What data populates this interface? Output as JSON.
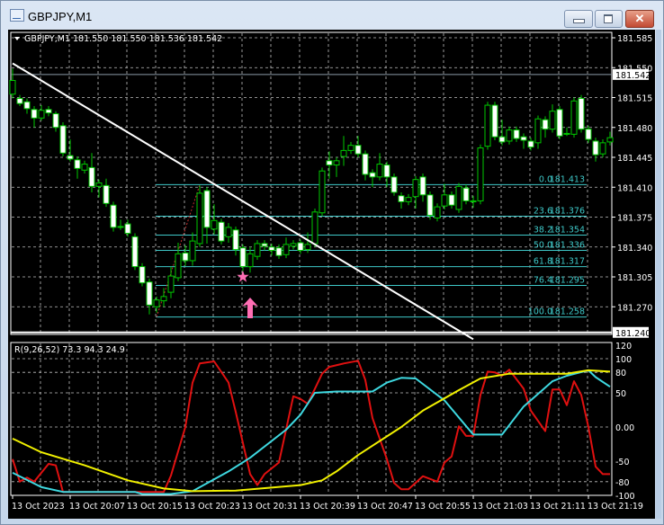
{
  "window": {
    "title": "GBPJPY,M1",
    "close_glyph": "✕"
  },
  "chart": {
    "header": "GBPJPY,M1  181.550 181.550 181.536 181.542",
    "colors": {
      "background": "#000000",
      "bull_body": "#000000",
      "bear_body": "#ffffff",
      "candle_outline": "#00c800",
      "grid": "#c0c0c0",
      "fib": "#3ec8c8",
      "trendline": "#ffffff",
      "marker": "#ff6eb4"
    },
    "price_axis": [
      "181.585",
      "181.550",
      "181.515",
      "181.480",
      "181.445",
      "181.410",
      "181.375",
      "181.340",
      "181.305",
      "181.270"
    ],
    "bid_price": "181.542",
    "hline_price": "181.240",
    "first_bar_time": "19:59",
    "time_axis": [
      {
        "time": "19:59",
        "label": "13 Oct 2023"
      },
      {
        "time": "20:07",
        "label": "13 Oct 20:07"
      },
      {
        "time": "20:15",
        "label": "13 Oct 20:15"
      },
      {
        "time": "20:23",
        "label": "13 Oct 20:23"
      },
      {
        "time": "20:31",
        "label": "13 Oct 20:31"
      },
      {
        "time": "20:39",
        "label": "13 Oct 20:39"
      },
      {
        "time": "20:47",
        "label": "13 Oct 20:47"
      },
      {
        "time": "20:55",
        "label": "13 Oct 20:55"
      },
      {
        "time": "21:03",
        "label": "13 Oct 21:03"
      },
      {
        "time": "21:11",
        "label": "13 Oct 21:11"
      },
      {
        "time": "21:19",
        "label": "13 Oct 21:19"
      }
    ],
    "candles_ohlc": [
      [
        181.519,
        181.549,
        181.514,
        181.535
      ],
      [
        181.514,
        181.518,
        181.505,
        181.508
      ],
      [
        181.51,
        181.514,
        181.496,
        181.502
      ],
      [
        181.501,
        181.505,
        181.48,
        181.491
      ],
      [
        181.491,
        181.506,
        181.488,
        181.5
      ],
      [
        181.501,
        181.505,
        181.493,
        181.497
      ],
      [
        181.496,
        181.499,
        181.475,
        181.48
      ],
      [
        181.482,
        181.486,
        181.446,
        181.45
      ],
      [
        181.447,
        181.466,
        181.44,
        181.443
      ],
      [
        181.442,
        181.446,
        181.42,
        181.432
      ],
      [
        181.43,
        181.441,
        181.426,
        181.437
      ],
      [
        181.433,
        181.45,
        181.404,
        181.411
      ],
      [
        181.411,
        181.419,
        181.398,
        181.415
      ],
      [
        181.412,
        181.42,
        181.387,
        181.391
      ],
      [
        181.389,
        181.393,
        181.358,
        181.363
      ],
      [
        181.364,
        181.372,
        181.36,
        181.364
      ],
      [
        181.367,
        181.372,
        181.352,
        181.356
      ],
      [
        181.352,
        181.356,
        181.313,
        181.317
      ],
      [
        181.317,
        181.321,
        181.294,
        181.298
      ],
      [
        181.299,
        181.303,
        181.261,
        181.272
      ],
      [
        181.27,
        181.282,
        181.263,
        181.278
      ],
      [
        181.277,
        181.292,
        181.27,
        181.282
      ],
      [
        181.287,
        181.317,
        181.28,
        181.306
      ],
      [
        181.304,
        181.345,
        181.3,
        181.332
      ],
      [
        181.333,
        181.342,
        181.318,
        181.324
      ],
      [
        181.324,
        181.357,
        181.318,
        181.347
      ],
      [
        181.344,
        181.412,
        181.34,
        181.403
      ],
      [
        181.406,
        181.41,
        181.344,
        181.363
      ],
      [
        181.361,
        181.39,
        181.355,
        181.371
      ],
      [
        181.369,
        181.373,
        181.343,
        181.347
      ],
      [
        181.352,
        181.368,
        181.345,
        181.363
      ],
      [
        181.36,
        181.364,
        181.33,
        181.337
      ],
      [
        181.339,
        181.343,
        181.312,
        181.317
      ],
      [
        181.317,
        181.34,
        181.31,
        181.332
      ],
      [
        181.329,
        181.348,
        181.325,
        181.344
      ],
      [
        181.344,
        181.348,
        181.336,
        181.341
      ],
      [
        181.34,
        181.344,
        181.33,
        181.336
      ],
      [
        181.339,
        181.343,
        181.326,
        181.33
      ],
      [
        181.331,
        181.351,
        181.327,
        181.343
      ],
      [
        181.341,
        181.348,
        181.337,
        181.344
      ],
      [
        181.345,
        181.349,
        181.332,
        181.336
      ],
      [
        181.337,
        181.357,
        181.333,
        181.343
      ],
      [
        181.344,
        181.385,
        181.34,
        181.381
      ],
      [
        181.38,
        181.433,
        181.376,
        181.429
      ],
      [
        181.441,
        181.452,
        181.42,
        181.436
      ],
      [
        181.436,
        181.445,
        181.422,
        181.441
      ],
      [
        181.446,
        181.47,
        181.435,
        181.453
      ],
      [
        181.453,
        181.463,
        181.449,
        181.459
      ],
      [
        181.459,
        181.47,
        181.445,
        181.449
      ],
      [
        181.449,
        181.453,
        181.418,
        181.425
      ],
      [
        181.427,
        181.431,
        181.41,
        181.422
      ],
      [
        181.422,
        181.45,
        181.418,
        181.437
      ],
      [
        181.436,
        181.44,
        181.41,
        181.422
      ],
      [
        181.422,
        181.426,
        181.4,
        181.404
      ],
      [
        181.4,
        181.404,
        181.385,
        181.393
      ],
      [
        181.393,
        181.402,
        181.389,
        181.398
      ],
      [
        181.399,
        181.423,
        181.385,
        181.419
      ],
      [
        181.422,
        181.426,
        181.393,
        181.401
      ],
      [
        181.401,
        181.405,
        181.372,
        181.377
      ],
      [
        181.374,
        181.391,
        181.37,
        181.387
      ],
      [
        181.388,
        181.414,
        181.384,
        181.401
      ],
      [
        181.401,
        181.405,
        181.385,
        181.389
      ],
      [
        181.384,
        181.415,
        181.38,
        181.411
      ],
      [
        181.409,
        181.413,
        181.39,
        181.394
      ],
      [
        181.394,
        181.4,
        181.386,
        181.394
      ],
      [
        181.394,
        181.46,
        181.39,
        181.456
      ],
      [
        181.458,
        181.51,
        181.454,
        181.506
      ],
      [
        181.506,
        181.51,
        181.465,
        181.469
      ],
      [
        181.469,
        181.489,
        181.459,
        181.463
      ],
      [
        181.464,
        181.481,
        181.46,
        181.477
      ],
      [
        181.477,
        181.481,
        181.463,
        181.467
      ],
      [
        181.469,
        181.473,
        181.455,
        181.465
      ],
      [
        181.464,
        181.468,
        181.453,
        181.457
      ],
      [
        181.462,
        181.494,
        181.455,
        181.49
      ],
      [
        181.489,
        181.493,
        181.468,
        181.478
      ],
      [
        181.478,
        181.507,
        181.474,
        181.499
      ],
      [
        181.501,
        181.505,
        181.466,
        181.47
      ],
      [
        181.473,
        181.48,
        181.47,
        181.473
      ],
      [
        181.472,
        181.515,
        181.468,
        181.511
      ],
      [
        181.514,
        181.518,
        181.474,
        181.478
      ],
      [
        181.478,
        181.482,
        181.462,
        181.466
      ],
      [
        181.464,
        181.468,
        181.44,
        181.448
      ],
      [
        181.449,
        181.466,
        181.445,
        181.462
      ],
      [
        181.463,
        181.475,
        181.459,
        181.468
      ]
    ],
    "fibonacci": {
      "start_time": "20:19",
      "levels": [
        {
          "level": "0.0",
          "price": "181.413"
        },
        {
          "level": "23.6",
          "price": "181.376"
        },
        {
          "level": "38.2",
          "price": "181.354"
        },
        {
          "level": "50.0",
          "price": "181.336"
        },
        {
          "level": "61.8",
          "price": "181.317"
        },
        {
          "level": "76.4",
          "price": "181.295"
        },
        {
          "level": "100.0",
          "price": "181.258"
        }
      ]
    },
    "trendline": {
      "from": [
        "19:59",
        181.555
      ],
      "to": [
        "21:03",
        181.232
      ]
    },
    "fib_anchor_line": {
      "from": [
        "20:19",
        181.258
      ],
      "to": [
        "20:25",
        181.413
      ]
    },
    "markers": [
      {
        "icon": "star-icon",
        "time": "20:31",
        "price": 181.305
      },
      {
        "icon": "arrow-up-icon",
        "time": "20:32",
        "price": 181.285
      }
    ]
  },
  "indicator": {
    "label": "R(9,26,52) 73.3 94.3 24.9",
    "axis": [
      "120",
      "100",
      "80",
      "50",
      "0.00",
      "-50",
      "-80",
      "-100"
    ],
    "axis_values": [
      120,
      100,
      80,
      50,
      0,
      -50,
      -80,
      -100
    ],
    "grid_values": [
      100,
      80,
      50,
      0,
      -50,
      -80
    ],
    "series": [
      {
        "color": "#e01010",
        "points": [
          [
            0,
            -47
          ],
          [
            1,
            -80
          ],
          [
            2,
            -74
          ],
          [
            3,
            -80
          ],
          [
            5,
            -54
          ],
          [
            6,
            -56
          ],
          [
            7,
            -95
          ],
          [
            21,
            -95
          ],
          [
            22,
            -71
          ],
          [
            24,
            0
          ],
          [
            25,
            65
          ],
          [
            26,
            93
          ],
          [
            28,
            96
          ],
          [
            30,
            65
          ],
          [
            31,
            22
          ],
          [
            33,
            -69
          ],
          [
            34,
            -85
          ],
          [
            35,
            -69
          ],
          [
            37,
            -52
          ],
          [
            39,
            45
          ],
          [
            40,
            41
          ],
          [
            41,
            34
          ],
          [
            43,
            78
          ],
          [
            44,
            88
          ],
          [
            46,
            93
          ],
          [
            48,
            97
          ],
          [
            49,
            69
          ],
          [
            50,
            13
          ],
          [
            52,
            -47
          ],
          [
            53,
            -82
          ],
          [
            54,
            -91
          ],
          [
            55,
            -91
          ],
          [
            57,
            -72
          ],
          [
            59,
            -80
          ],
          [
            60,
            -52
          ],
          [
            61,
            -43
          ],
          [
            62,
            1
          ],
          [
            63,
            -13
          ],
          [
            64,
            -13
          ],
          [
            65,
            47
          ],
          [
            66,
            81
          ],
          [
            67,
            80
          ],
          [
            68,
            75
          ],
          [
            69,
            84
          ],
          [
            71,
            56
          ],
          [
            72,
            24
          ],
          [
            74,
            -6
          ],
          [
            75,
            55
          ],
          [
            76,
            55
          ],
          [
            77,
            32
          ],
          [
            78,
            67
          ],
          [
            79,
            47
          ],
          [
            80,
            0
          ],
          [
            81,
            -58
          ],
          [
            82,
            -69
          ],
          [
            83,
            -69
          ]
        ]
      },
      {
        "color": "#3ed8e0",
        "points": [
          [
            0,
            -67
          ],
          [
            4,
            -88
          ],
          [
            7,
            -95
          ],
          [
            17,
            -95
          ],
          [
            18,
            -98
          ],
          [
            22,
            -98
          ],
          [
            25,
            -94
          ],
          [
            30,
            -65
          ],
          [
            33,
            -45
          ],
          [
            38,
            -4
          ],
          [
            40,
            18
          ],
          [
            42,
            50
          ],
          [
            45,
            52
          ],
          [
            50,
            52
          ],
          [
            52,
            65
          ],
          [
            54,
            72
          ],
          [
            56,
            71
          ],
          [
            60,
            39
          ],
          [
            64,
            -11
          ],
          [
            68,
            -11
          ],
          [
            71,
            30
          ],
          [
            75,
            67
          ],
          [
            77,
            75
          ],
          [
            80,
            83
          ],
          [
            81,
            73
          ],
          [
            83,
            59
          ]
        ]
      },
      {
        "color": "#f0f000",
        "points": [
          [
            0,
            -17
          ],
          [
            4,
            -37
          ],
          [
            10,
            -56
          ],
          [
            16,
            -78
          ],
          [
            21,
            -90
          ],
          [
            25,
            -94
          ],
          [
            31,
            -93
          ],
          [
            40,
            -85
          ],
          [
            43,
            -78
          ],
          [
            45,
            -65
          ],
          [
            48,
            -41
          ],
          [
            54,
            0
          ],
          [
            57,
            24
          ],
          [
            62,
            54
          ],
          [
            65,
            71
          ],
          [
            69,
            78
          ],
          [
            77,
            78
          ],
          [
            80,
            83
          ],
          [
            83,
            81
          ]
        ]
      }
    ]
  }
}
